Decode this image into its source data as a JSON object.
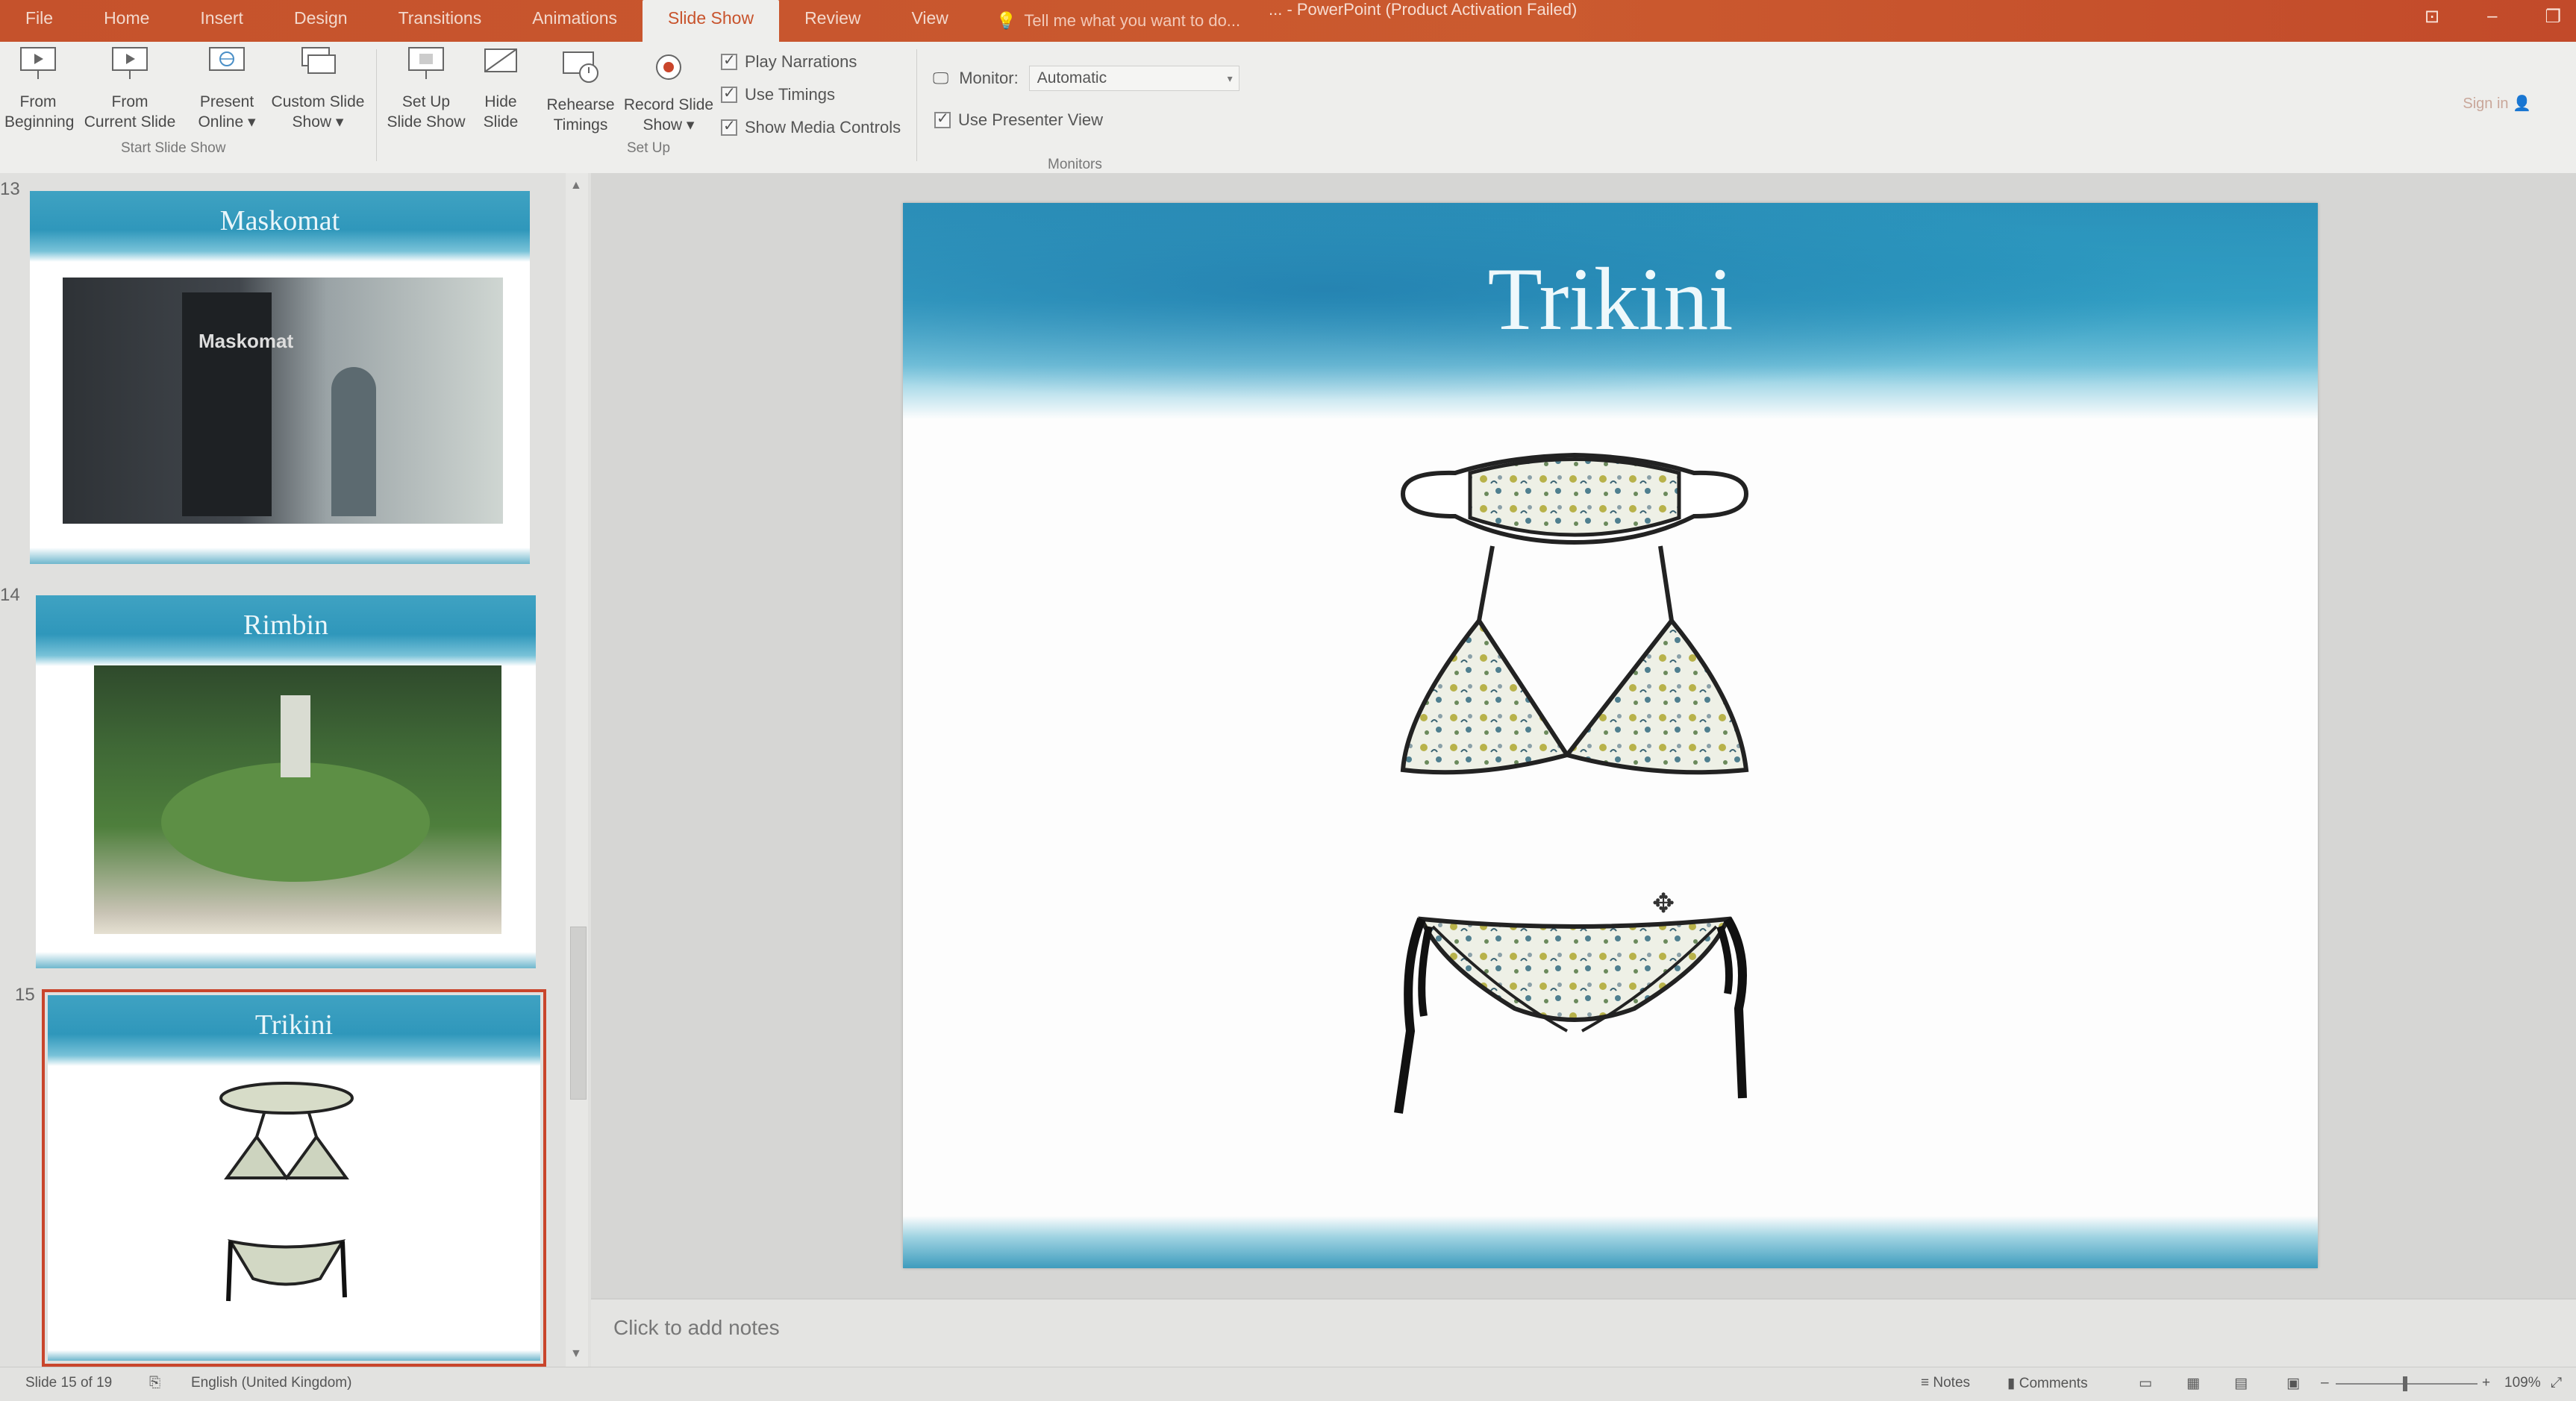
{
  "tabs": [
    "File",
    "Home",
    "Insert",
    "Design",
    "Transitions",
    "Animations",
    "Slide Show",
    "Review",
    "View"
  ],
  "active_tab": "Slide Show",
  "tell_me": "Tell me what you want to do...",
  "document_title": "... - PowerPoint (Product Activation Failed)",
  "sign_in": "Sign in",
  "ribbon": {
    "from_beginning": [
      "From",
      "Beginning"
    ],
    "from_current": [
      "From",
      "Current Slide"
    ],
    "present_online": [
      "Present",
      "Online ▾"
    ],
    "custom_slide_show": [
      "Custom Slide",
      "Show ▾"
    ],
    "group_start": "Start Slide Show",
    "set_up_slide_show": [
      "Set Up",
      "Slide Show"
    ],
    "hide_slide": [
      "Hide",
      "Slide"
    ],
    "rehearse_timings": [
      "Rehearse",
      "Timings"
    ],
    "record_slide_show": [
      "Record Slide",
      "Show ▾"
    ],
    "play_narrations": "Play Narrations",
    "use_timings": "Use Timings",
    "show_media_controls": "Show Media Controls",
    "group_setup": "Set Up",
    "monitor_label": "Monitor:",
    "monitor_value": "Automatic",
    "use_presenter_view": "Use Presenter View",
    "group_monitors": "Monitors"
  },
  "thumbnails": [
    {
      "number": "13",
      "title": "Maskomat",
      "photo_text": "Maskomat"
    },
    {
      "number": "14",
      "title": "Rimbin"
    },
    {
      "number": "15",
      "title": "Trikini"
    }
  ],
  "slide": {
    "title": "Trikini"
  },
  "notes_placeholder": "Click to add notes",
  "status": {
    "slide_info": "Slide 15 of 19",
    "language": "English (United Kingdom)",
    "notes": "Notes",
    "comments": "Comments",
    "zoom": "109%"
  },
  "colors": {
    "accent": "#c5522c",
    "selection": "#c9452b",
    "sea": "#2b8fb8"
  }
}
